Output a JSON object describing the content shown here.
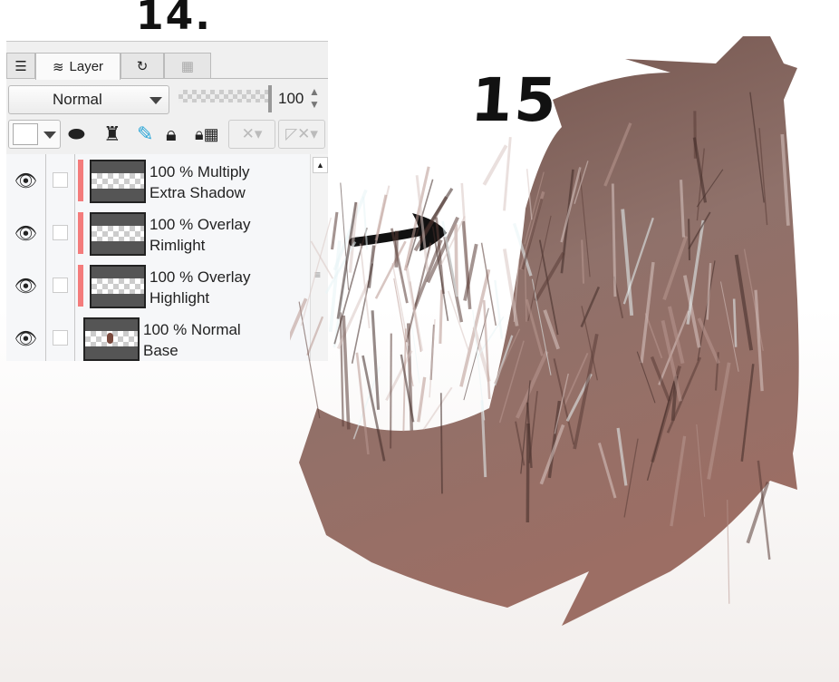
{
  "annotations": {
    "step_14": "14.",
    "step_15": "15."
  },
  "panel": {
    "tabs": [
      {
        "label": "Layer",
        "icon": "layer-stack-icon",
        "active": true
      },
      {
        "label": "",
        "icon": "history-icon"
      },
      {
        "label": "",
        "icon": "navigator-icon"
      }
    ],
    "blend_mode": "Normal",
    "opacity": "100",
    "toolbar_icons": [
      "color-swatch-icon",
      "clipping-icon",
      "reference-layer-icon",
      "draft-pen-icon",
      "lock-icon",
      "lock-transparency-icon",
      "mask-icon",
      "ruler-icon"
    ],
    "layers": [
      {
        "mode": "100 % Multiply",
        "name": "Extra Shadow",
        "clipped": true
      },
      {
        "mode": "100 % Overlay",
        "name": "Rimlight",
        "clipped": true
      },
      {
        "mode": "100 % Overlay",
        "name": "Highlight",
        "clipped": true
      },
      {
        "mode": "100 % Normal",
        "name": "Base",
        "clipped": false
      }
    ]
  },
  "colors": {
    "clip_indicator": "#f47c7c",
    "tail_base": "#8a6a62",
    "tail_highlight": "#d9c7c2"
  }
}
